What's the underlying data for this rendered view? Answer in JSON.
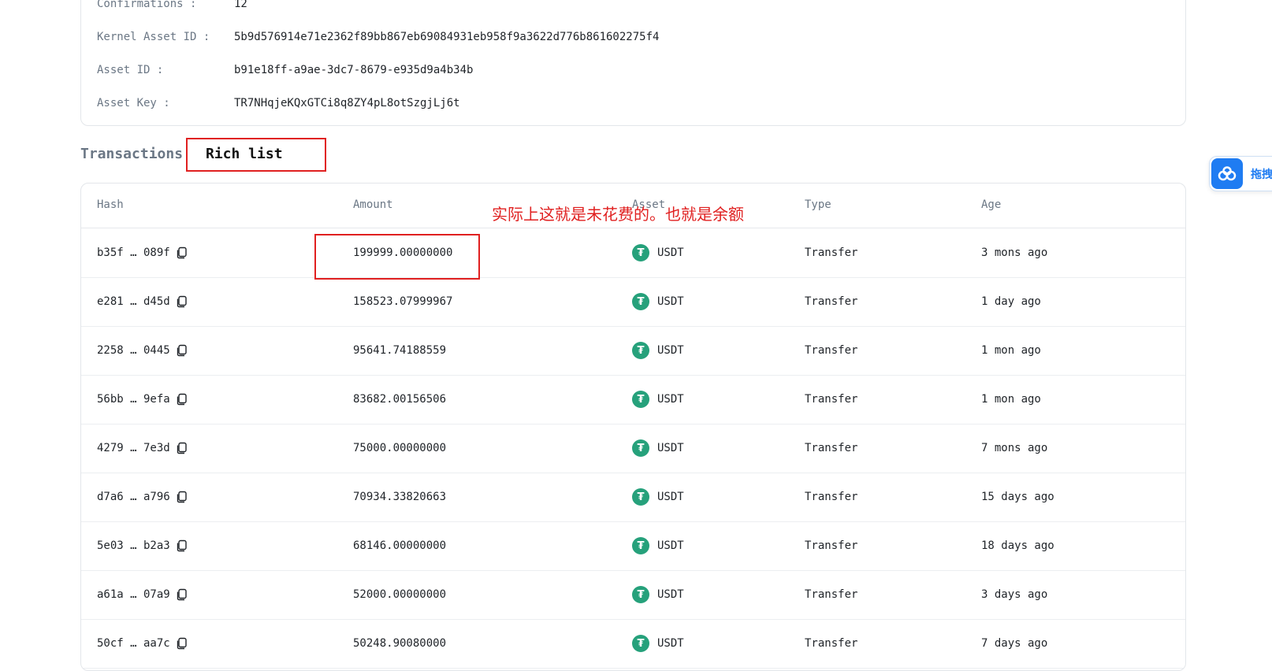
{
  "info": {
    "confirmations_label": "Confirmations :",
    "confirmations_value": "12",
    "kernel_asset_id_label": "Kernel Asset ID :",
    "kernel_asset_id_value": "5b9d576914e71e2362f89bb867eb69084931eb958f9a3622d776b861602275f4",
    "asset_id_label": "Asset ID :",
    "asset_id_value": "b91e18ff-a9ae-3dc7-8679-e935d9a4b34b",
    "asset_key_label": "Asset Key :",
    "asset_key_value": "TR7NHqjeKQxGTCi8q8ZY4pL8otSzgjLj6t"
  },
  "tabs": {
    "transactions": "Transactions",
    "rich_list": "Rich list"
  },
  "table": {
    "headers": {
      "hash": "Hash",
      "amount": "Amount",
      "asset": "Asset",
      "type": "Type",
      "age": "Age"
    },
    "rows": [
      {
        "hash": "b35f … 089f",
        "amount": "199999.00000000",
        "asset": "USDT",
        "type": "Transfer",
        "age": "3 mons ago"
      },
      {
        "hash": "e281 … d45d",
        "amount": "158523.07999967",
        "asset": "USDT",
        "type": "Transfer",
        "age": "1 day ago"
      },
      {
        "hash": "2258 … 0445",
        "amount": "95641.74188559",
        "asset": "USDT",
        "type": "Transfer",
        "age": "1 mon ago"
      },
      {
        "hash": "56bb … 9efa",
        "amount": "83682.00156506",
        "asset": "USDT",
        "type": "Transfer",
        "age": "1 mon ago"
      },
      {
        "hash": "4279 … 7e3d",
        "amount": "75000.00000000",
        "asset": "USDT",
        "type": "Transfer",
        "age": "7 mons ago"
      },
      {
        "hash": "d7a6 … a796",
        "amount": "70934.33820663",
        "asset": "USDT",
        "type": "Transfer",
        "age": "15 days ago"
      },
      {
        "hash": "5e03 … b2a3",
        "amount": "68146.00000000",
        "asset": "USDT",
        "type": "Transfer",
        "age": "18 days ago"
      },
      {
        "hash": "a61a … 07a9",
        "amount": "52000.00000000",
        "asset": "USDT",
        "type": "Transfer",
        "age": "3 days ago"
      },
      {
        "hash": "50cf … aa7c",
        "amount": "50248.90080000",
        "asset": "USDT",
        "type": "Transfer",
        "age": "7 days ago"
      }
    ]
  },
  "annotation": {
    "text": "实际上这就是未花费的。也就是余额"
  },
  "widget": {
    "label": "拖拽"
  },
  "colors": {
    "accent_red": "#e02020",
    "usdt_green": "#26a17b",
    "widget_blue": "#1f7cf2"
  }
}
